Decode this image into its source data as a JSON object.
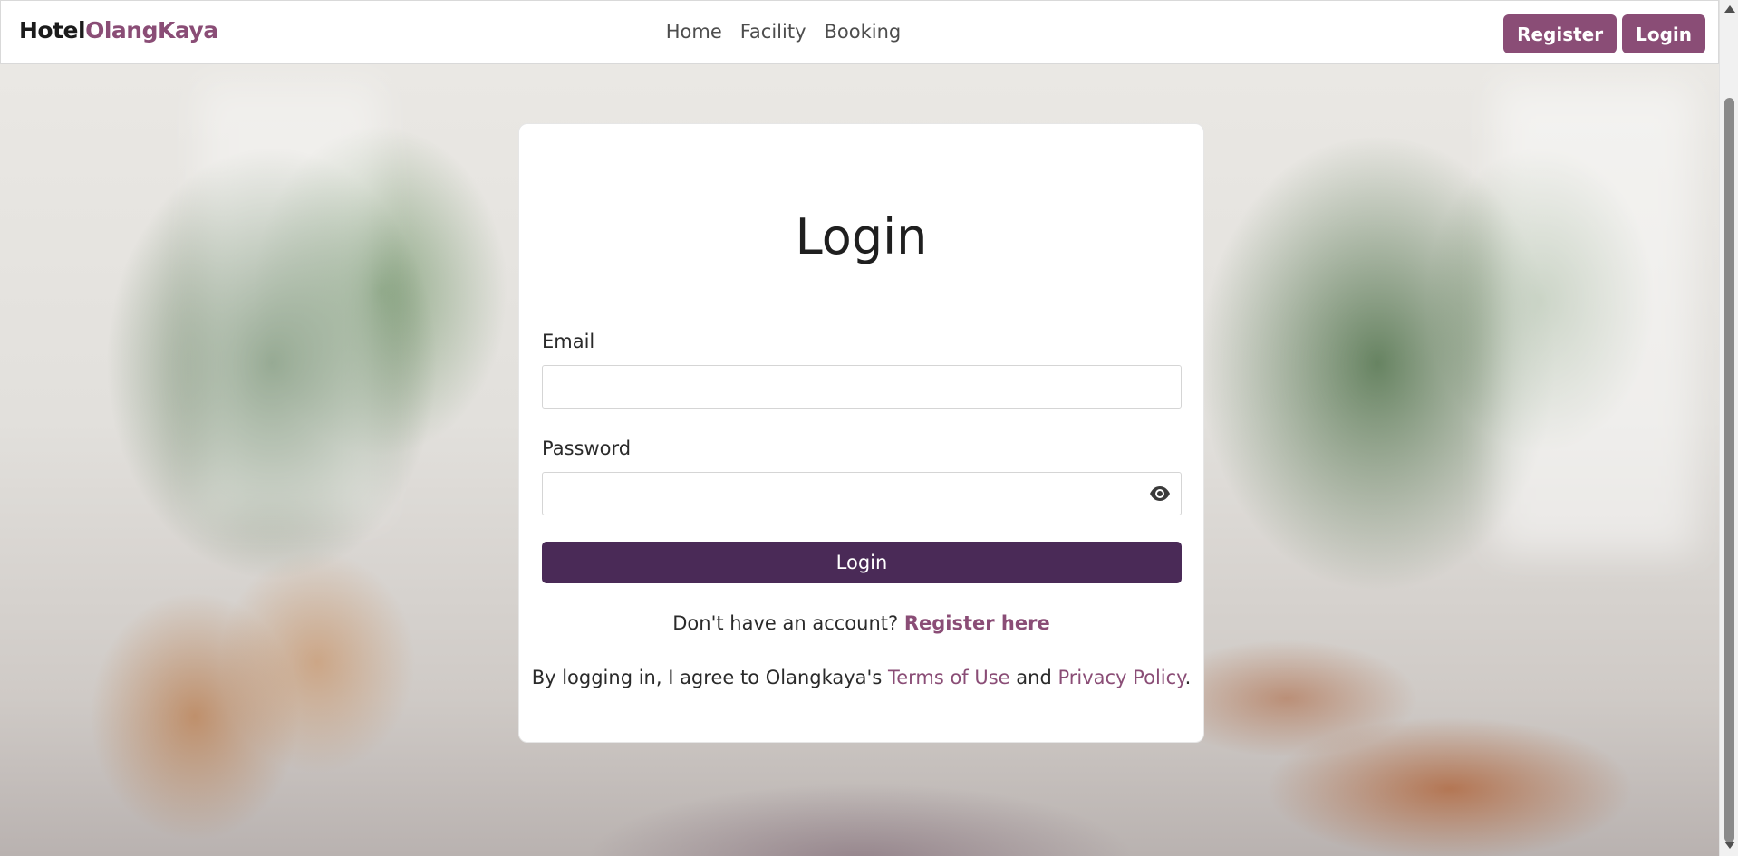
{
  "brand": {
    "part1": "Hotel",
    "part2": "OlangKaya"
  },
  "nav": {
    "links": [
      "Home",
      "Facility",
      "Booking"
    ],
    "register_button": "Register",
    "login_button": "Login"
  },
  "card": {
    "title": "Login",
    "email_label": "Email",
    "email_value": "",
    "password_label": "Password",
    "password_value": "",
    "submit_label": "Login",
    "signup_prompt": "Don't have an account? ",
    "signup_link": "Register here",
    "terms_prefix": "By logging in, I agree to Olangkaya's ",
    "terms_link": "Terms of Use",
    "terms_and": " and ",
    "privacy_link": "Privacy Policy",
    "terms_suffix": "."
  },
  "colors": {
    "accent": "#8a4d76",
    "primary_button": "#4a2a57"
  },
  "icons": {
    "password_toggle": "eye-icon"
  }
}
